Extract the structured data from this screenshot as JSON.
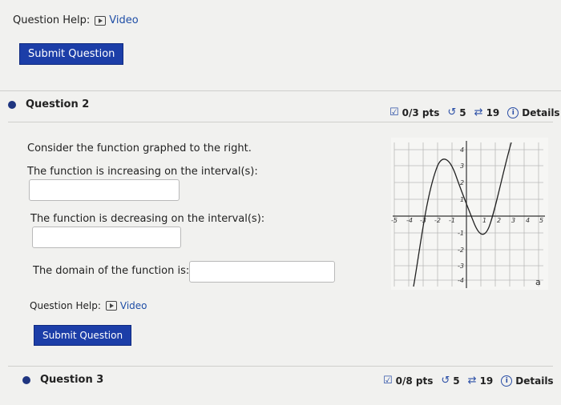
{
  "top_help": {
    "label": "Question Help:",
    "video_label": "Video"
  },
  "top_submit": {
    "label": "Submit Question"
  },
  "question2": {
    "title": "Question 2",
    "points": "0/3 pts",
    "retries": "5",
    "attempts": "19",
    "details": "Details",
    "prompt": "Consider the function graphed to the right.",
    "increasing_label": "The function is increasing on the interval(s):",
    "increasing_value": "",
    "decreasing_label": "The function is decreasing on the interval(s):",
    "decreasing_value": "",
    "domain_label": "The domain of the function is:",
    "domain_value": "",
    "help_label": "Question Help:",
    "video_label": "Video",
    "submit_label": "Submit Question"
  },
  "question3": {
    "title": "Question 3",
    "points": "0/8 pts",
    "retries": "5",
    "attempts": "19",
    "details": "Details"
  },
  "graph": {
    "x_ticks": [
      "-5",
      "-4",
      "-3",
      "-2",
      "-1",
      "1",
      "2",
      "3",
      "4",
      "5"
    ],
    "y_ticks": [
      "4",
      "3",
      "2",
      "1",
      "-1",
      "-2",
      "-3",
      "-4"
    ],
    "end_label": "a"
  },
  "colors": {
    "accent": "#1c3ea8",
    "link": "#1f4ea6",
    "bullet": "#1f3580"
  }
}
